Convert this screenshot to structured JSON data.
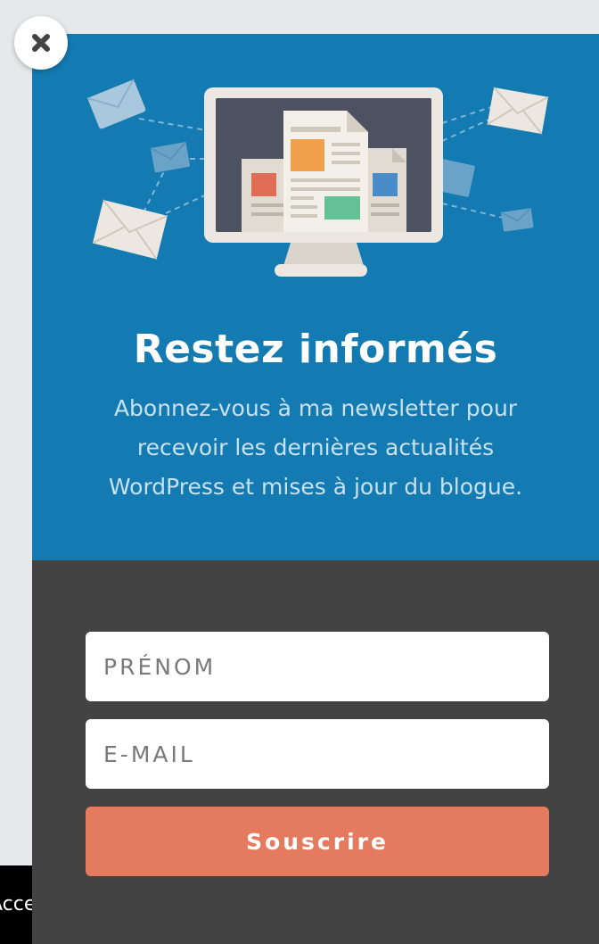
{
  "background": {
    "cookie_bar_text": "Accepter"
  },
  "popup": {
    "title": "Restez informés",
    "subtitle": "Abonnez-vous à ma newsletter pour recevoir les dernières actualités WordPress et mises à jour du blogue.",
    "form": {
      "first_name_placeholder": "PRÉNOM",
      "first_name_value": "",
      "email_placeholder": "E-MAIL",
      "email_value": "",
      "submit_label": "Souscrire"
    },
    "close_icon": "close-icon"
  },
  "colors": {
    "header_blue": "#137ab2",
    "form_dark": "#444343",
    "accent_orange": "#e47b5e",
    "subtitle_light_blue": "#c9e1f0"
  }
}
